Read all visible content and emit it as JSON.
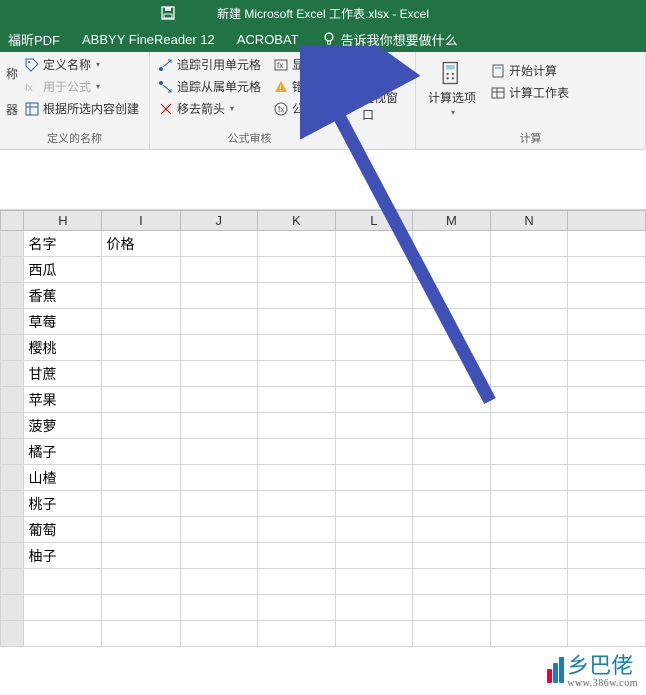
{
  "title": "新建 Microsoft Excel 工作表.xlsx - Excel",
  "tabs": {
    "foxit": "福昕PDF",
    "abbyy": "ABBYY FineReader 12",
    "acrobat": "ACROBAT",
    "tellme": "告诉我你想要做什么"
  },
  "ribbon": {
    "group1": {
      "define_name": "定义名称",
      "use_in_formula": "用于公式",
      "create_from_selection": "根据所选内容创建",
      "label": "定义的名称",
      "side_label1": "称",
      "side_label2": "器"
    },
    "group2": {
      "trace_precedents": "追踪引用单元格",
      "trace_dependents": "追踪从属单元格",
      "remove_arrows": "移去箭头",
      "show_formulas": "显示公式",
      "error_checking": "错误检",
      "evaluate_formula": "公式求",
      "label": "公式审核"
    },
    "group3": {
      "watch_window": "监视窗口"
    },
    "group4": {
      "calc_options": "计算选项",
      "calc_now": "开始计算",
      "calc_sheet": "计算工作表",
      "label": "计算"
    }
  },
  "columns": [
    "H",
    "I",
    "J",
    "K",
    "L",
    "M",
    "N"
  ],
  "rows": [
    {
      "h": "名字",
      "i": "价格"
    },
    {
      "h": "西瓜",
      "i": ""
    },
    {
      "h": "香蕉",
      "i": ""
    },
    {
      "h": "草莓",
      "i": ""
    },
    {
      "h": "樱桃",
      "i": ""
    },
    {
      "h": "甘蔗",
      "i": ""
    },
    {
      "h": "苹果",
      "i": ""
    },
    {
      "h": "菠萝",
      "i": ""
    },
    {
      "h": "橘子",
      "i": ""
    },
    {
      "h": "山楂",
      "i": ""
    },
    {
      "h": "桃子",
      "i": ""
    },
    {
      "h": "葡萄",
      "i": ""
    },
    {
      "h": "柚子",
      "i": ""
    }
  ],
  "watermark": {
    "text": "乡巴佬",
    "url": "www.386w.com"
  }
}
